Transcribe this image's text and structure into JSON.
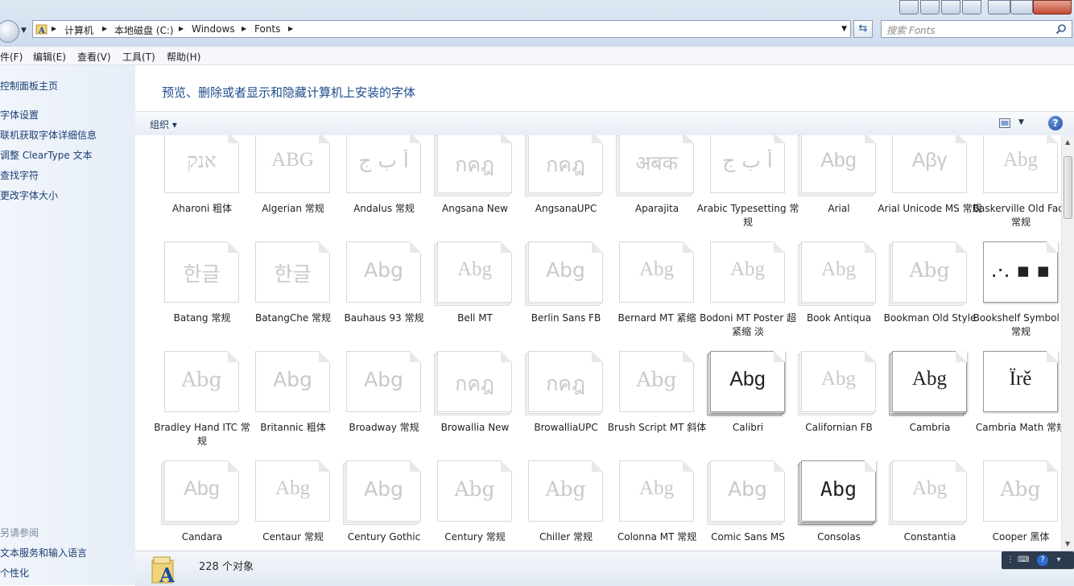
{
  "address": {
    "crumbs": [
      "计算机",
      "本地磁盘 (C:)",
      "Windows",
      "Fonts"
    ]
  },
  "search": {
    "placeholder": "搜索 Fonts"
  },
  "menu": [
    "件(F)",
    "编辑(E)",
    "查看(V)",
    "工具(T)",
    "帮助(H)"
  ],
  "left_panel": {
    "links": [
      "控制面板主页",
      "字体设置",
      "联机获取字体详细信息",
      "调整 ClearType 文本",
      "查找字符",
      "更改字体大小"
    ],
    "see_also_title": "另请参阅",
    "see_also": [
      "文本服务和输入语言",
      "个性化"
    ]
  },
  "header": {
    "title": "预览、删除或者显示和隐藏计算机上安装的字体"
  },
  "toolbar": {
    "organize": "组织",
    "help": "?"
  },
  "fonts": [
    {
      "name": "Aharoni 粗体",
      "sample": "אנק",
      "family": "\"DejaVu Serif\", serif",
      "stack": 1,
      "dark": false
    },
    {
      "name": "Algerian 常规",
      "sample": "ABG",
      "family": "\"Liberation Serif\", serif",
      "stack": 1,
      "dark": false
    },
    {
      "name": "Andalus 常规",
      "sample": "أ ب ج",
      "family": "\"DejaVu Sans\", sans-serif",
      "stack": 1,
      "dark": false
    },
    {
      "name": "Angsana New",
      "sample": "กคฎ",
      "family": "\"DejaVu Sans\", sans-serif",
      "stack": 3,
      "dark": false
    },
    {
      "name": "AngsanaUPC",
      "sample": "กคฎ",
      "family": "\"DejaVu Sans\", sans-serif",
      "stack": 3,
      "dark": false
    },
    {
      "name": "Aparajita",
      "sample": "अबक",
      "family": "\"DejaVu Sans\", sans-serif",
      "stack": 3,
      "dark": false
    },
    {
      "name": "Arabic Typesetting 常规",
      "sample": "أ ب ج",
      "family": "\"DejaVu Serif\", serif",
      "stack": 1,
      "dark": false
    },
    {
      "name": "Arial",
      "sample": "Abg",
      "family": "\"Liberation Sans\", sans-serif",
      "stack": 3,
      "dark": false
    },
    {
      "name": "Arial Unicode MS 常规",
      "sample": "Αβγ",
      "family": "\"Liberation Sans\", sans-serif",
      "stack": 1,
      "dark": false
    },
    {
      "name": "Baskerville Old Face 常规",
      "sample": "Abg",
      "family": "\"Liberation Serif\", serif",
      "stack": 1,
      "dark": false
    },
    {
      "name": "Batang 常规",
      "sample": "한글",
      "family": "\"DejaVu Serif\", serif",
      "stack": 1,
      "dark": false
    },
    {
      "name": "BatangChe 常规",
      "sample": "한글",
      "family": "\"DejaVu Serif\", serif",
      "stack": 1,
      "dark": false
    },
    {
      "name": "Bauhaus 93 常规",
      "sample": "Abg",
      "family": "\"DejaVu Sans\", sans-serif",
      "stack": 1,
      "dark": false
    },
    {
      "name": "Bell MT",
      "sample": "Abg",
      "family": "\"Liberation Serif\", serif",
      "stack": 3,
      "dark": false
    },
    {
      "name": "Berlin Sans FB",
      "sample": "Abg",
      "family": "\"DejaVu Sans\", sans-serif",
      "stack": 3,
      "dark": false
    },
    {
      "name": "Bernard MT 紧缩",
      "sample": "Abg",
      "family": "\"Liberation Serif\", serif",
      "stack": 1,
      "dark": false
    },
    {
      "name": "Bodoni MT Poster 超紧缩 淡",
      "sample": "Abg",
      "family": "\"Liberation Serif\", serif",
      "stack": 1,
      "dark": false
    },
    {
      "name": "Book Antiqua",
      "sample": "Abg",
      "family": "\"Liberation Serif\", serif",
      "stack": 3,
      "dark": false
    },
    {
      "name": "Bookman Old Style",
      "sample": "Abg",
      "family": "\"DejaVu Serif\", serif",
      "stack": 3,
      "dark": false
    },
    {
      "name": "Bookshelf Symbol 7 常规",
      "sample": ".·.  ▪  ▪",
      "family": "\"DejaVu Sans\", sans-serif",
      "stack": 1,
      "dark": true
    },
    {
      "name": "Bradley Hand ITC 常规",
      "sample": "Abg",
      "family": "\"DejaVu Serif\", serif",
      "stack": 1,
      "dark": false
    },
    {
      "name": "Britannic 粗体",
      "sample": "Abg",
      "family": "\"DejaVu Sans\", sans-serif",
      "stack": 1,
      "dark": false
    },
    {
      "name": "Broadway 常规",
      "sample": "Abg",
      "family": "\"DejaVu Sans\", sans-serif",
      "stack": 1,
      "dark": false
    },
    {
      "name": "Browallia New",
      "sample": "กคฎ",
      "family": "\"DejaVu Sans\", sans-serif",
      "stack": 3,
      "dark": false
    },
    {
      "name": "BrowalliaUPC",
      "sample": "กคฎ",
      "family": "\"DejaVu Sans\", sans-serif",
      "stack": 3,
      "dark": false
    },
    {
      "name": "Brush Script MT 斜体",
      "sample": "Abg",
      "family": "\"DejaVu Serif\", serif",
      "stack": 1,
      "dark": false
    },
    {
      "name": "Calibri",
      "sample": "Abg",
      "family": "\"Liberation Sans\", sans-serif",
      "stack": 3,
      "dark": true
    },
    {
      "name": "Californian FB",
      "sample": "Abg",
      "family": "\"Liberation Serif\", serif",
      "stack": 3,
      "dark": false
    },
    {
      "name": "Cambria",
      "sample": "Abg",
      "family": "\"Liberation Serif\", serif",
      "stack": 3,
      "dark": true
    },
    {
      "name": "Cambria Math 常规",
      "sample": "Ïrě",
      "family": "\"Liberation Serif\", serif",
      "stack": 1,
      "dark": true
    },
    {
      "name": "Candara",
      "sample": "Abg",
      "family": "\"Liberation Sans\", sans-serif",
      "stack": 3,
      "dark": false
    },
    {
      "name": "Centaur 常规",
      "sample": "Abg",
      "family": "\"Liberation Serif\", serif",
      "stack": 1,
      "dark": false
    },
    {
      "name": "Century Gothic",
      "sample": "Abg",
      "family": "\"DejaVu Sans\", sans-serif",
      "stack": 3,
      "dark": false
    },
    {
      "name": "Century 常规",
      "sample": "Abg",
      "family": "\"DejaVu Serif\", serif",
      "stack": 1,
      "dark": false
    },
    {
      "name": "Chiller 常规",
      "sample": "Abg",
      "family": "\"DejaVu Serif\", serif",
      "stack": 1,
      "dark": false
    },
    {
      "name": "Colonna MT 常规",
      "sample": "Abg",
      "family": "\"Liberation Serif\", serif",
      "stack": 1,
      "dark": false
    },
    {
      "name": "Comic Sans MS",
      "sample": "Abg",
      "family": "\"DejaVu Sans\", sans-serif",
      "stack": 3,
      "dark": false
    },
    {
      "name": "Consolas",
      "sample": "Abg",
      "family": "\"DejaVu Sans Mono\", monospace",
      "stack": 3,
      "dark": true
    },
    {
      "name": "Constantia",
      "sample": "Abg",
      "family": "\"Liberation Serif\", serif",
      "stack": 3,
      "dark": false
    },
    {
      "name": "Cooper 黑体",
      "sample": "Abg",
      "family": "\"DejaVu Serif\", serif",
      "stack": 1,
      "dark": false
    }
  ],
  "status": {
    "count": "228 个对象"
  }
}
